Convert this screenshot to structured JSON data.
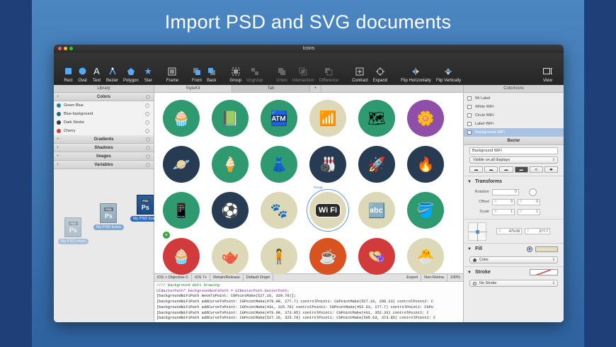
{
  "headline": "Import PSD and SVG documents",
  "window": {
    "title": "Icons"
  },
  "toolbar": {
    "items": [
      {
        "label": "Rect",
        "icon": "rect-icon"
      },
      {
        "label": "Oval",
        "icon": "oval-icon"
      },
      {
        "label": "Text",
        "icon": "text-icon"
      },
      {
        "label": "Bezier",
        "icon": "bezier-icon"
      },
      {
        "label": "Polygon",
        "icon": "polygon-icon"
      },
      {
        "label": "Star",
        "icon": "star-icon"
      },
      {
        "label": "Frame",
        "icon": "frame-icon"
      },
      {
        "label": "Front",
        "icon": "front-icon"
      },
      {
        "label": "Back",
        "icon": "back-icon"
      },
      {
        "label": "Group",
        "icon": "group-icon"
      },
      {
        "label": "Ungroup",
        "icon": "ungroup-icon"
      },
      {
        "label": "Union",
        "icon": "union-icon"
      },
      {
        "label": "Intersection",
        "icon": "intersection-icon"
      },
      {
        "label": "Difference",
        "icon": "difference-icon"
      },
      {
        "label": "Contract",
        "icon": "contract-icon"
      },
      {
        "label": "Expand",
        "icon": "expand-icon"
      },
      {
        "label": "Flip Horizontally",
        "icon": "flip-horizontal-icon"
      },
      {
        "label": "Flip Vertically",
        "icon": "flip-vertical-icon"
      },
      {
        "label": "View",
        "icon": "view-icon"
      }
    ]
  },
  "tabs": {
    "library": "Library",
    "stylekit": "StyleKit",
    "tab": "Tab",
    "add": "+",
    "right": "ColorIcons"
  },
  "library": {
    "colors_header": "Colors",
    "colors": [
      {
        "name": "Green Blue",
        "color": "#1e8a8a"
      },
      {
        "name": "Blue background",
        "color": "#1f6b86"
      },
      {
        "name": "Dark Stroke",
        "color": "#2a3a45"
      },
      {
        "name": "Cherry",
        "color": "#d23b3b"
      }
    ],
    "gradients": "Gradients",
    "shadows": "Shadows",
    "images": "Images",
    "variables": "Variables",
    "drag_items": [
      "My PSD Icons",
      "My PSD Icons",
      "My PSD Icons"
    ],
    "psd_tag": "PSD",
    "ps_text": "Ps",
    "add_badge": "+"
  },
  "canvas": {
    "icons": [
      {
        "name": "cupcake",
        "glyph": "🧁",
        "bg": "#2f9a6f"
      },
      {
        "name": "book",
        "glyph": "📗",
        "bg": "#2f9a6f"
      },
      {
        "name": "machine",
        "glyph": "🏧",
        "bg": "#2f9a6f"
      },
      {
        "name": "wifi",
        "glyph": "📶",
        "bg": "#ddd8b8"
      },
      {
        "name": "map",
        "glyph": "🗺",
        "bg": "#2f9a6f"
      },
      {
        "name": "hand-flower",
        "glyph": "🌼",
        "bg": "#8f4fa8"
      },
      {
        "name": "planet",
        "glyph": "🪐",
        "bg": "#273c52"
      },
      {
        "name": "ice-cream",
        "glyph": "🍦",
        "bg": "#2f9a6f"
      },
      {
        "name": "dress",
        "glyph": "👗",
        "bg": "#2f9a6f"
      },
      {
        "name": "bowling",
        "glyph": "🎳",
        "bg": "#273c52"
      },
      {
        "name": "rocket",
        "glyph": "🚀",
        "bg": "#273c52"
      },
      {
        "name": "match",
        "glyph": "🔥",
        "bg": "#273c52"
      },
      {
        "name": "phone",
        "glyph": "📱",
        "bg": "#2f9a6f"
      },
      {
        "name": "ball",
        "glyph": "⚽",
        "bg": "#273c52"
      },
      {
        "name": "paw",
        "glyph": "🐾",
        "bg": "#ddd8b8"
      },
      {
        "name": "wifi-label",
        "glyph": "Wi Fi",
        "bg": "#ddd8b8"
      },
      {
        "name": "blocks",
        "glyph": "🔤",
        "bg": "#ddd8b8"
      },
      {
        "name": "bucket",
        "glyph": "🪣",
        "bg": "#2f9a6f"
      },
      {
        "name": "cupcake-2",
        "glyph": "🧁",
        "bg": "#d23b3b"
      },
      {
        "name": "kettle",
        "glyph": "🫖",
        "bg": "#ddd8b8"
      },
      {
        "name": "figure",
        "glyph": "🧍",
        "bg": "#ddd8b8"
      },
      {
        "name": "cup",
        "glyph": "☕",
        "bg": "#d8531f"
      },
      {
        "name": "hat",
        "glyph": "👒",
        "bg": "#d23b3b"
      },
      {
        "name": "chick",
        "glyph": "🐣",
        "bg": "#ddd8b8"
      }
    ],
    "selection_label": "Group"
  },
  "codebar": {
    "language": "iOS > Objective-C",
    "target": "iOS 7+",
    "memory": "Retain/Release",
    "origin": "Default Origin",
    "export": "Export",
    "retina": "Non-Retina",
    "zoom": "100%"
  },
  "code": {
    "lines": [
      "//// Background WiFi Drawing",
      "UIBezierPath* backgroundWiFiPath = UIBezierPath.bezierPath;",
      "[backgroundWiFiPath moveToPoint: CGPointMake(527.16, 329.78)];",
      "[backgroundWiFiPath addCurveToPoint: CGPointMake(479.08, 277.7) controlPoint1: CGPointMake(527.16, 298.23) controlPoint2: C",
      "[backgroundWiFiPath addCurveToPoint: CGPointMake(431, 325.78) controlPoint1: CGPointMake(452.53, 277.7) controlPoint2: CGPo",
      "[backgroundWiFiPath addCurveToPoint: CGPointMake(479.08, 373.85) controlPoint1: CGPointMake(431, 352.33) controlPoint2: C",
      "[backgroundWiFiPath addCurveToPoint: CGPointMake(527.16, 325.78) controlPoint1: CGPointMake(505.63, 373.85) controlPoint2: C"
    ]
  },
  "inspector": {
    "layers": [
      "Wi Label",
      "White WiFi",
      "Circle WiFi",
      "Label WiFi",
      "Background WiFi"
    ],
    "selected_index": 4,
    "section_bezier": "Bezier",
    "name_field": "Background WiFi",
    "visibility": "Visible on all displays",
    "transforms_title": "Transforms",
    "rotation_label": "Rotation",
    "rotation_value": "0",
    "offset_label": "Offset",
    "offset_x": "0",
    "offset_y": "0",
    "scale_label": "Scale",
    "scale_x": "1",
    "scale_y": "1",
    "pos_x": "479.08",
    "pos_y": "277.7",
    "x_axis": "X",
    "y_axis": "Y",
    "fill_title": "Fill",
    "fill_value": "Color",
    "stroke_title": "Stroke",
    "stroke_value": "No Stroke"
  }
}
